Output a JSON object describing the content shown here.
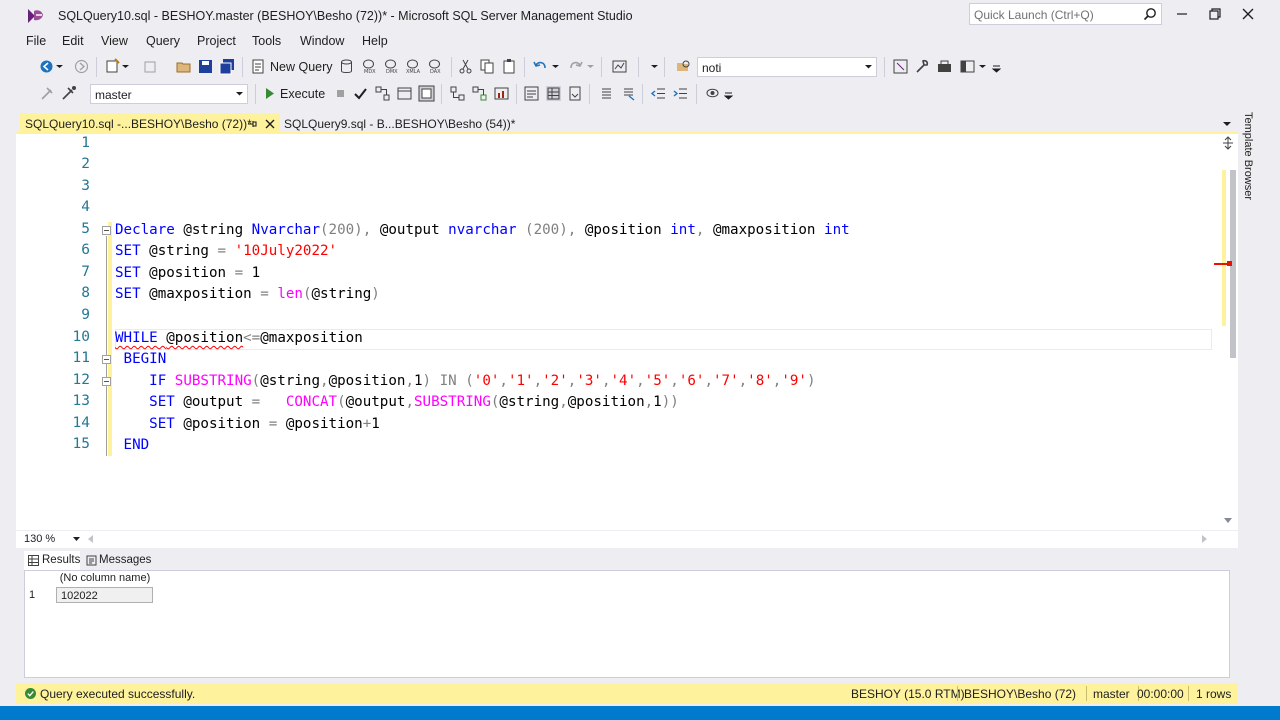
{
  "window": {
    "title": "SQLQuery10.sql - BESHOY.master (BESHOY\\Besho (72))* - Microsoft SQL Server Management Studio",
    "quick_launch_placeholder": "Quick Launch (Ctrl+Q)"
  },
  "menu": [
    "File",
    "Edit",
    "View",
    "Query",
    "Project",
    "Tools",
    "Window",
    "Help"
  ],
  "toolbar": {
    "new_query_label": "New Query",
    "search_combo_value": "noti",
    "database_combo_value": "master",
    "execute_label": "Execute"
  },
  "tabs": [
    {
      "label": "SQLQuery10.sql -...BESHOY\\Besho (72))*",
      "active": true
    },
    {
      "label": "SQLQuery9.sql - B...BESHOY\\Besho (54))*",
      "active": false
    }
  ],
  "side_panel": {
    "template_browser_label": "Template Browser"
  },
  "editor": {
    "line_numbers": [
      "1",
      "2",
      "3",
      "4",
      "5",
      "6",
      "7",
      "8",
      "9",
      "10",
      "11",
      "12",
      "13",
      "14",
      "15"
    ],
    "zoom": "130 %"
  },
  "code": {
    "l5": {
      "a": "Declare",
      "b": " @string ",
      "c": "Nvarchar",
      "d": "(200)",
      "e": ",",
      "f": " @output ",
      "g": "nvarchar",
      "h": " (200)",
      "i": ",",
      "j": " @position ",
      "k": "int",
      "l": ",",
      "m": " @maxposition ",
      "n": "int"
    },
    "l6": {
      "a": "SET",
      "b": " @string ",
      "c": "=",
      "d": " ",
      "e": "'10July2022'"
    },
    "l7": {
      "a": "SET",
      "b": " @position ",
      "c": "=",
      "d": " 1"
    },
    "l8": {
      "a": "SET",
      "b": " @maxposition ",
      "c": "=",
      "d": " ",
      "e": "len",
      "f": "(",
      "g": "@string",
      "h": ")"
    },
    "l10": {
      "a": "WHILE",
      "b": " ",
      "c": "@position",
      "d": "<=",
      "e": "@maxposition"
    },
    "l11": {
      "a": " BEGIN"
    },
    "l12": {
      "a": "    IF",
      "b": " ",
      "c": "SUBSTRING",
      "d": "(",
      "e": "@string",
      "f": ",",
      "g": "@position",
      "h": ",",
      "i": "1",
      "j": ")",
      "k": " IN ",
      "l": "(",
      "m": "'0'",
      "n": ",",
      "o": "'1'",
      "p": ",",
      "q": "'2'",
      "r": ",",
      "s": "'3'",
      "t": ",",
      "u": "'4'",
      "v": ",",
      "w": "'5'",
      "x": ",",
      "y": "'6'",
      "z": ",",
      "aa": "'7'",
      "ab": ",",
      "ac": "'8'",
      "ad": ",",
      "ae": "'9'",
      "af": ")"
    },
    "l13": {
      "a": "    SET",
      "b": " @output ",
      "c": "=",
      "d": "   ",
      "e": "CONCAT",
      "f": "(",
      "g": "@output",
      "h": ",",
      "i": "SUBSTRING",
      "j": "(",
      "k": "@string",
      "l": ",",
      "m": "@position",
      "n": ",",
      "o": "1",
      "p": "))"
    },
    "l14": {
      "a": "    SET",
      "b": " @position ",
      "c": "=",
      "d": " @position",
      "e": "+",
      "f": "1"
    },
    "l15": {
      "a": " END"
    }
  },
  "results": {
    "tab_results": "Results",
    "tab_messages": "Messages",
    "column_header": "(No column name)",
    "row_number": "1",
    "cell_value": "102022"
  },
  "status": {
    "message": "Query executed successfully.",
    "server": "BESHOY (15.0 RTM)",
    "user": "BESHOY\\Besho (72)",
    "database": "master",
    "elapsed": "00:00:00",
    "rows": "1 rows"
  },
  "colors": {
    "keyword": "#0000ff",
    "string": "#ff0000",
    "function": "#ff00ff",
    "operator": "#808080",
    "line_number": "#237893",
    "accent_tab": "#fff29d",
    "status_bar": "#fff29d"
  }
}
